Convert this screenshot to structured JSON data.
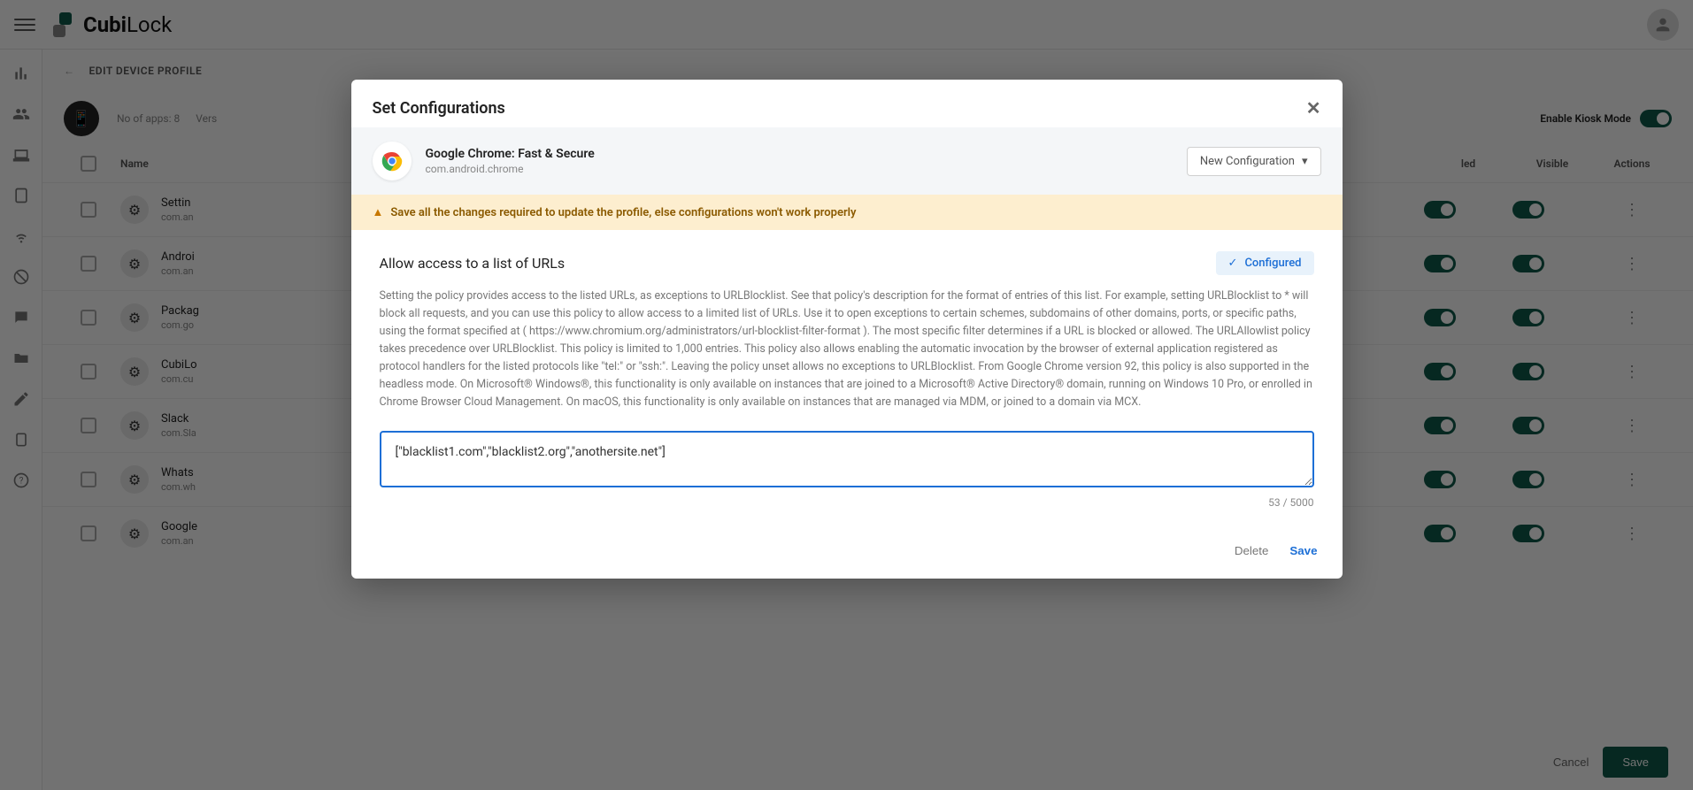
{
  "brand": {
    "part1": "Cubi",
    "part2": "Lock"
  },
  "breadcrumb": {
    "edit_label": "EDIT DEVICE PROFILE"
  },
  "profile": {
    "apps_label": "No of apps:",
    "apps_count": "8",
    "vers_label": "Vers"
  },
  "kiosk": {
    "label": "Enable Kiosk Mode"
  },
  "columns": {
    "name": "Name",
    "third": "led",
    "visible": "Visible",
    "actions": "Actions"
  },
  "rows": [
    {
      "name": "Settin",
      "pkg": "com.an"
    },
    {
      "name": "Androi",
      "pkg": "com.an"
    },
    {
      "name": "Packag",
      "pkg": "com.go"
    },
    {
      "name": "CubiLo",
      "pkg": "com.cu"
    },
    {
      "name": "Slack",
      "pkg": "com.Sla"
    },
    {
      "name": "Whats",
      "pkg": "com.wh"
    },
    {
      "name": "Google",
      "pkg": "com.an"
    }
  ],
  "footer": {
    "cancel": "Cancel",
    "save": "Save"
  },
  "modal": {
    "title": "Set Configurations",
    "app_name": "Google Chrome: Fast & Secure",
    "app_pkg": "com.android.chrome",
    "new_config": "New Configuration",
    "warning": "Save all the changes required to update the profile, else configurations won't work properly",
    "config_title": "Allow access to a list of URLs",
    "configured": "Configured",
    "desc": "Setting the policy provides access to the listed URLs, as exceptions to URLBlocklist. See that policy's description for the format of entries of this list. For example, setting URLBlocklist to * will block all requests, and you can use this policy to allow access to a limited list of URLs. Use it to open exceptions to certain schemes, subdomains of other domains, ports, or specific paths, using the format specified at ( https://www.chromium.org/administrators/url-blocklist-filter-format ). The most specific filter determines if a URL is blocked or allowed. The URLAllowlist policy takes precedence over URLBlocklist. This policy is limited to 1,000 entries. This policy also allows enabling the automatic invocation by the browser of external application registered as protocol handlers for the listed protocols like \"tel:\" or \"ssh:\". Leaving the policy unset allows no exceptions to URLBlocklist. From Google Chrome version 92, this policy is also supported in the headless mode. On Microsoft® Windows®, this functionality is only available on instances that are joined to a Microsoft® Active Directory® domain, running on Windows 10 Pro, or enrolled in Chrome Browser Cloud Management. On macOS, this functionality is only available on instances that are managed via MDM, or joined to a domain via MCX.",
    "input_value": "[\"blacklist1.com\",\"blacklist2.org\",\"anothersite.net\"]",
    "char_count": "53 / 5000",
    "delete": "Delete",
    "save": "Save"
  }
}
